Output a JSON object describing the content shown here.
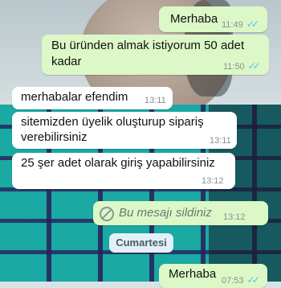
{
  "messages": [
    {
      "text": "Merhaba",
      "time": "11:49",
      "ticks": "✓✓"
    },
    {
      "text_line1": "Bu üründen almak istiyorum 50 adet",
      "text_line2": "kadar",
      "time": "11:50",
      "ticks": "✓✓"
    },
    {
      "text": "merhabalar efendim",
      "time": "13:11"
    },
    {
      "text_line1": "sitemizden üyelik oluşturup sipariş",
      "text_line2": "verebilirsiniz",
      "time": "13:11"
    },
    {
      "text": "25 şer adet olarak giriş yapabilirsiniz",
      "time": "13:12"
    },
    {
      "text": "Bu mesajı sildiniz",
      "time": "13:12",
      "icon": "ban-icon"
    },
    {
      "text": "Merhaba",
      "time": "07:53",
      "ticks": "✓✓"
    }
  ],
  "date_divider": "Cumartesi",
  "colors": {
    "outgoing": "#dcf8c6",
    "incoming": "#ffffff",
    "read_ticks": "#4fc3f7"
  }
}
